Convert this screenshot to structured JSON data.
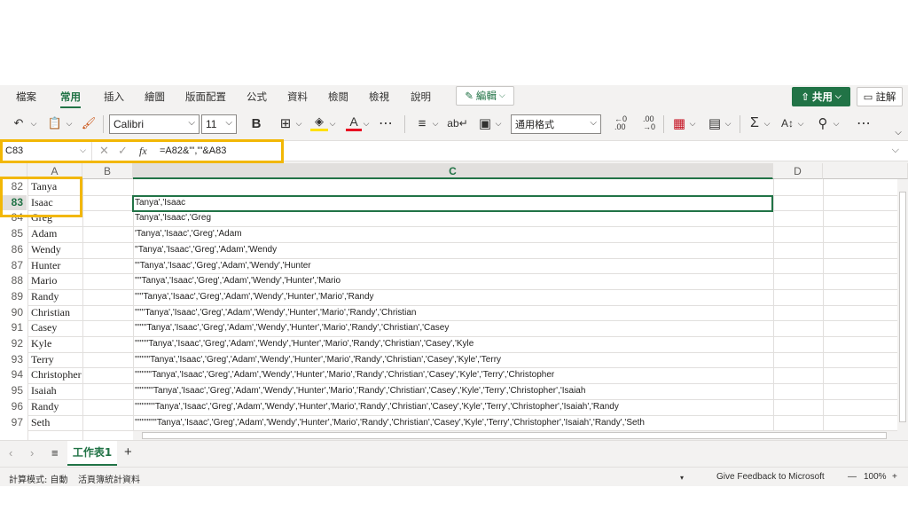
{
  "ribbon": {
    "tabs": [
      "檔案",
      "常用",
      "插入",
      "繪圖",
      "版面配置",
      "公式",
      "資料",
      "檢閱",
      "檢視",
      "說明"
    ],
    "active_tab": "常用",
    "edit_label": "編輯",
    "share_label": "共用",
    "comments_label": "註解"
  },
  "toolbar": {
    "font_name": "Calibri",
    "font_size": "11",
    "bold_label": "B",
    "number_format": "通用格式"
  },
  "formula_bar": {
    "name_box": "C83",
    "fx_label": "fx",
    "formula": "=A82&\"','\"&A83"
  },
  "columns": [
    "A",
    "B",
    "C",
    "D"
  ],
  "selected_column": "C",
  "rows": [
    {
      "num": "82",
      "a": "Tanya",
      "c": ""
    },
    {
      "num": "83",
      "a": "Isaac",
      "c": "Tanya','Isaac"
    },
    {
      "num": "84",
      "a": "Greg",
      "c": "Tanya','Isaac','Greg"
    },
    {
      "num": "85",
      "a": "Adam",
      "c": "'Tanya','Isaac','Greg','Adam"
    },
    {
      "num": "86",
      "a": "Wendy",
      "c": "''Tanya','Isaac','Greg','Adam','Wendy"
    },
    {
      "num": "87",
      "a": "Hunter",
      "c": "'''Tanya','Isaac','Greg','Adam','Wendy','Hunter"
    },
    {
      "num": "88",
      "a": "Mario",
      "c": "''''Tanya','Isaac','Greg','Adam','Wendy','Hunter','Mario"
    },
    {
      "num": "89",
      "a": "Randy",
      "c": "'''''Tanya','Isaac','Greg','Adam','Wendy','Hunter','Mario','Randy"
    },
    {
      "num": "90",
      "a": "Christian",
      "c": "''''''Tanya','Isaac','Greg','Adam','Wendy','Hunter','Mario','Randy','Christian"
    },
    {
      "num": "91",
      "a": "Casey",
      "c": "'''''''Tanya','Isaac','Greg','Adam','Wendy','Hunter','Mario','Randy','Christian','Casey"
    },
    {
      "num": "92",
      "a": "Kyle",
      "c": "''''''''Tanya','Isaac','Greg','Adam','Wendy','Hunter','Mario','Randy','Christian','Casey','Kyle"
    },
    {
      "num": "93",
      "a": "Terry",
      "c": "'''''''''Tanya','Isaac','Greg','Adam','Wendy','Hunter','Mario','Randy','Christian','Casey','Kyle','Terry"
    },
    {
      "num": "94",
      "a": "Christopher",
      "c": "''''''''''Tanya','Isaac','Greg','Adam','Wendy','Hunter','Mario','Randy','Christian','Casey','Kyle','Terry','Christopher"
    },
    {
      "num": "95",
      "a": "Isaiah",
      "c": "'''''''''''Tanya','Isaac','Greg','Adam','Wendy','Hunter','Mario','Randy','Christian','Casey','Kyle','Terry','Christopher','Isaiah"
    },
    {
      "num": "96",
      "a": "Randy",
      "c": "''''''''''''Tanya','Isaac','Greg','Adam','Wendy','Hunter','Mario','Randy','Christian','Casey','Kyle','Terry','Christopher','Isaiah','Randy"
    },
    {
      "num": "97",
      "a": "Seth",
      "c": "'''''''''''''Tanya','Isaac','Greg','Adam','Wendy','Hunter','Mario','Randy','Christian','Casey','Kyle','Terry','Christopher','Isaiah','Randy','Seth"
    }
  ],
  "sheets": {
    "active": "工作表1",
    "add_label": "+"
  },
  "status_bar": {
    "calc_mode": "計算模式: 自動",
    "workbook_stats": "活頁簿統計資料",
    "feedback": "Give Feedback to Microsoft",
    "zoom": "100%",
    "zoom_minus": "—",
    "zoom_plus": "+"
  },
  "colors": {
    "accent": "#217346",
    "highlight": "#f2b705"
  }
}
